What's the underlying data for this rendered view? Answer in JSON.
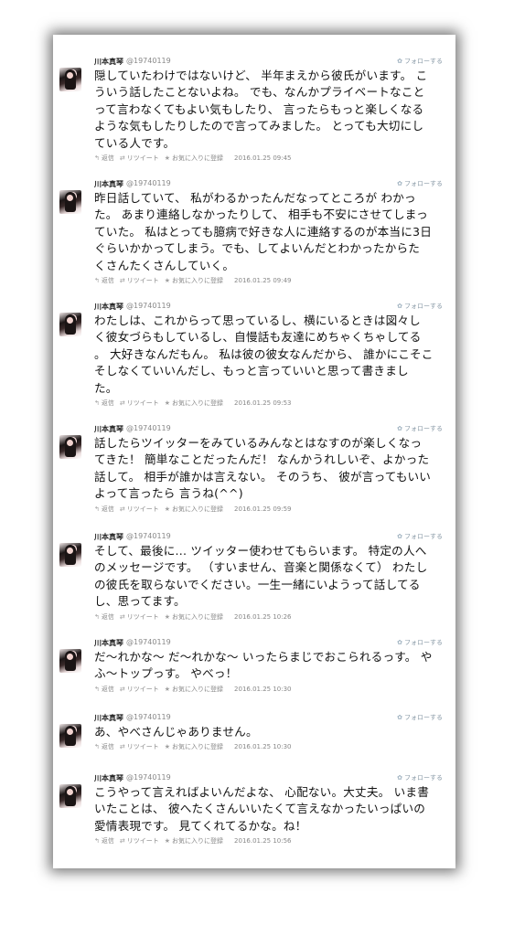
{
  "user": {
    "name": "川本真琴",
    "handle": "@19740119",
    "follow_label": "フォローする"
  },
  "action_labels": {
    "reply": "返信",
    "retweet": "リツイート",
    "favorite": "お気に入りに登録"
  },
  "tweets": [
    {
      "lines": [
        "隠していたわけではないけど、 半年まえから彼氏がいます。 こ",
        "ういう話したことないよね。 でも、なんかプライベートなこと",
        "って言わなくてもよい気もしたり、 言ったらもっと楽しくなる",
        "ような気もしたりしたので言ってみました。 とっても大切にし",
        "ている人です。"
      ],
      "date": "2016.01.25 09:45"
    },
    {
      "lines": [
        "昨日話していて、 私がわるかったんだなってところが わかっ",
        "た。 あまり連絡しなかったりして、 相手も不安にさせてしまっ",
        "ていた。 私はとっても臆病で好きな人に連絡するのが本当に3日",
        "ぐらいかかってしまう。でも、してよいんだとわかったからた",
        "くさんたくさんしていく。"
      ],
      "date": "2016.01.25 09:49"
    },
    {
      "lines": [
        "わたしは、これからって思っているし、横にいるときは図々し",
        "く彼女づらもしているし、自慢話も友達にめちゃくちゃしてる",
        "。 大好きなんだもん。 私は彼の彼女なんだから、 誰かにこそこ",
        "そしなくていいんだし、もっと言っていいと思って書きまし",
        "た。"
      ],
      "date": "2016.01.25 09:53"
    },
    {
      "lines": [
        "話したらツイッターをみているみんなとはなすのが楽しくなっ",
        "てきた！ 簡単なことだったんだ！ なんかうれしいぞ、よかった",
        "話して。 相手が誰かは言えない。 そのうち、 彼が言ってもいい",
        "よって言ったら 言うね(^^)"
      ],
      "date": "2016.01.25 09:59"
    },
    {
      "lines": [
        "そして、最後に... ツイッター使わせてもらいます。 特定の人へ",
        "のメッセージです。 （すいません、音楽と関係なくて） わたし",
        "の彼氏を取らないでください。一生一緒にいようって話してる",
        "し、思ってます。"
      ],
      "date": "2016.01.25 10:26"
    },
    {
      "lines": [
        "だ〜れかな〜 だ〜れかな〜 いったらまじでおこられるっす。 や",
        "ふ〜トップっす。 やべっ！"
      ],
      "date": "2016.01.25 10:30"
    },
    {
      "lines": [
        "あ、やべさんじゃありません。"
      ],
      "date": "2016.01.25 10:30"
    },
    {
      "lines": [
        "こうやって言えればよいんだよな、 心配ない。大丈夫。 いま書",
        "いたことは、 彼へたくさんいいたくて言えなかったいっぱいの",
        "愛情表現です。 見てくれてるかな。ね！"
      ],
      "date": "2016.01.25 10:56"
    }
  ]
}
